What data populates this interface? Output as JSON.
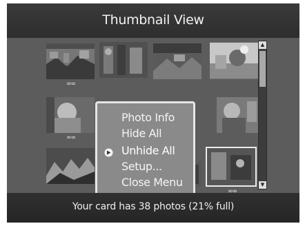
{
  "header": {
    "title": "Thumbnail View"
  },
  "thumbnails": [
    {
      "id": "t1",
      "hidden": true
    },
    {
      "id": "t2",
      "hidden": false
    },
    {
      "id": "t3",
      "hidden": false
    },
    {
      "id": "t4",
      "hidden": false
    },
    {
      "id": "t5",
      "hidden": false
    },
    {
      "id": "t6",
      "hidden": false
    },
    {
      "id": "t7",
      "hidden": false
    },
    {
      "id": "t8",
      "hidden": false
    },
    {
      "id": "t9",
      "hidden": true
    },
    {
      "id": "t10",
      "hidden": false
    },
    {
      "id": "t11",
      "hidden": true
    },
    {
      "id": "t12",
      "hidden": true
    }
  ],
  "hidden_marker": "∞∞",
  "menu": {
    "items": [
      {
        "label": "Photo Info"
      },
      {
        "label": "Hide All"
      },
      {
        "label": "Unhide All"
      },
      {
        "label": "Setup..."
      },
      {
        "label": "Close Menu"
      }
    ],
    "selected_index": 2
  },
  "status": {
    "text": "Your card has 38 photos (21% full)"
  },
  "colors": {
    "background": "#585858",
    "bar": "#2e2e2e",
    "menu": "#8a8a8a",
    "menu_border": "#e6e6e6",
    "text": "#f2f2f2"
  }
}
